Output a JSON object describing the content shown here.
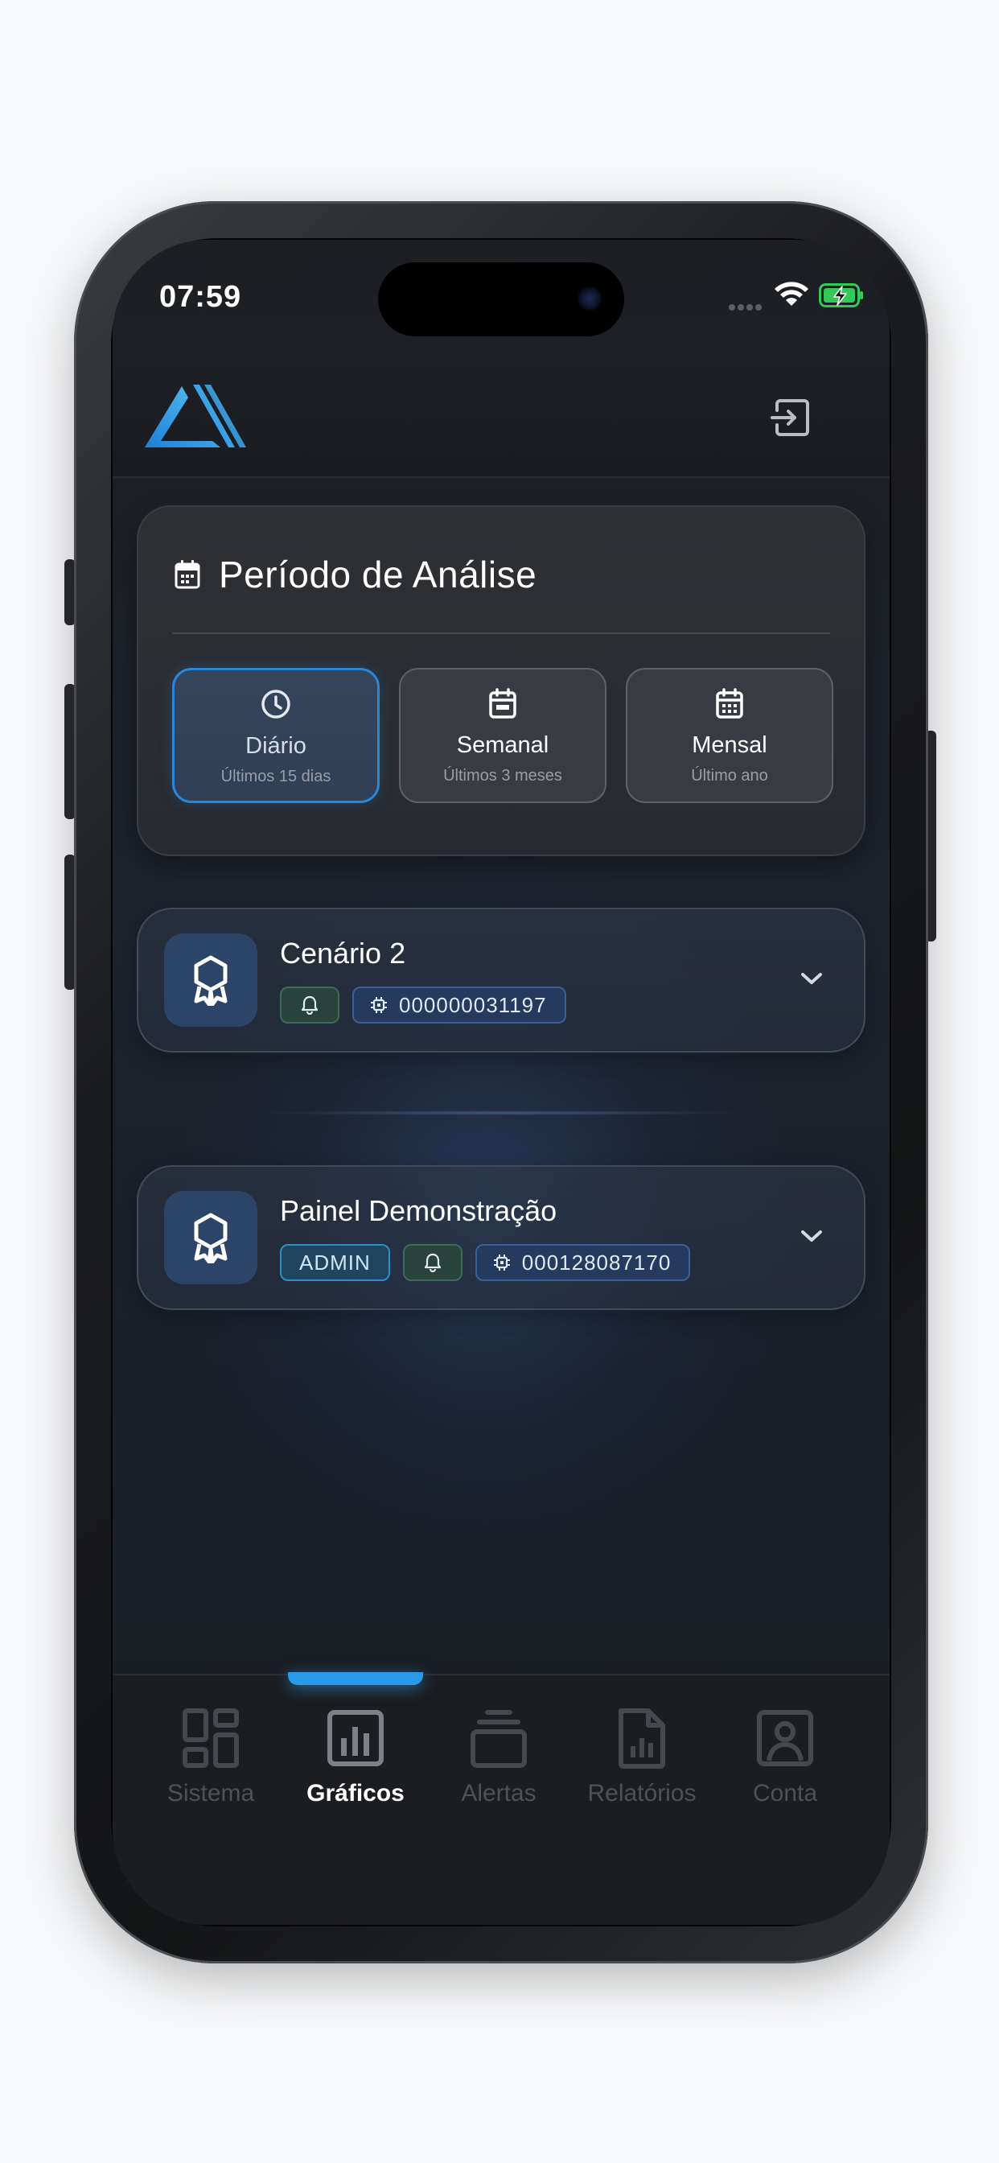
{
  "status_bar": {
    "time": "07:59"
  },
  "colors": {
    "accent": "#2a86d9",
    "nav_indicator": "#2a9ae8",
    "battery_green": "#34c759",
    "bell_chip": "#27433b",
    "id_chip": "#243a5f",
    "admin_chip": "#1f4560"
  },
  "header": {
    "logo_icon": "brand-triangle-logo",
    "logout_icon": "logout-icon"
  },
  "period": {
    "title": "Período de Análise",
    "icon": "calendar-icon",
    "options": [
      {
        "label": "Diário",
        "sub": "Últimos 15 dias",
        "icon": "clock-icon",
        "selected": true
      },
      {
        "label": "Semanal",
        "sub": "Últimos 3 meses",
        "icon": "calendar-icon",
        "selected": false
      },
      {
        "label": "Mensal",
        "sub": "Último ano",
        "icon": "calendar-grid-icon",
        "selected": false
      }
    ]
  },
  "devices": [
    {
      "name": "Cenário 2",
      "badges": [],
      "bell_icon": "bell-icon",
      "chip_icon": "chip-icon",
      "device_id": "000000031197",
      "avatar_icon": "award-icon"
    },
    {
      "name": "Painel Demonstração",
      "badges": [
        "ADMIN"
      ],
      "bell_icon": "bell-icon",
      "chip_icon": "chip-icon",
      "device_id": "000128087170",
      "avatar_icon": "award-icon"
    }
  ],
  "nav": {
    "items": [
      {
        "label": "Sistema",
        "icon": "dashboard-icon",
        "active": false
      },
      {
        "label": "Gráficos",
        "icon": "bar-chart-icon",
        "active": true
      },
      {
        "label": "Alertas",
        "icon": "layers-icon",
        "active": false
      },
      {
        "label": "Relatórios",
        "icon": "report-icon",
        "active": false
      },
      {
        "label": "Conta",
        "icon": "user-account-icon",
        "active": false
      }
    ]
  }
}
